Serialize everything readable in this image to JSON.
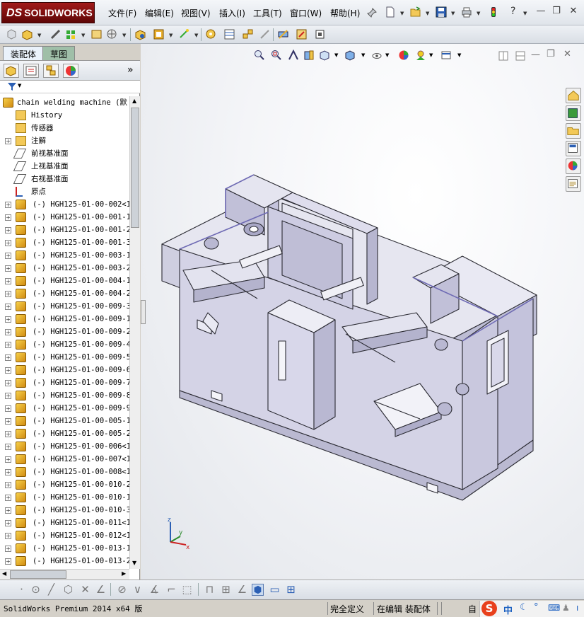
{
  "app": {
    "logo_prefix": "DS",
    "logo_text": "SOLIDWORKS"
  },
  "menu": [
    "文件(F)",
    "编辑(E)",
    "视图(V)",
    "插入(I)",
    "工具(T)",
    "窗口(W)",
    "帮助(H)"
  ],
  "titlebar_icons": [
    "pushpin-icon",
    "new-document-icon",
    "open-folder-icon",
    "save-icon",
    "print-icon",
    "rebuild-traffic-light-icon",
    "help-icon"
  ],
  "panel": {
    "tabs": [
      "装配体",
      "草图"
    ],
    "expand_symbol": "»"
  },
  "tree": [
    {
      "label": "chain welding machine (默",
      "icon": "assembly-icon",
      "expand": ""
    },
    {
      "label": "History",
      "icon": "history-icon",
      "expand": ""
    },
    {
      "label": "传感器",
      "icon": "sensor-icon",
      "expand": ""
    },
    {
      "label": "注解",
      "icon": "annotation-icon",
      "expand": "+"
    },
    {
      "label": "前视基准面",
      "icon": "plane-icon",
      "expand": ""
    },
    {
      "label": "上视基准面",
      "icon": "plane-icon",
      "expand": ""
    },
    {
      "label": "右视基准面",
      "icon": "plane-icon",
      "expand": ""
    },
    {
      "label": "原点",
      "icon": "origin-icon",
      "expand": ""
    },
    {
      "label": "(-) HGH125-01-00-002<1>",
      "icon": "part-icon",
      "expand": "+"
    },
    {
      "label": "(-) HGH125-01-00-001-1<",
      "icon": "part-icon",
      "expand": "+"
    },
    {
      "label": "(-) HGH125-01-00-001-2<",
      "icon": "part-icon",
      "expand": "+"
    },
    {
      "label": "(-) HGH125-01-00-001-3<",
      "icon": "part-icon",
      "expand": "+"
    },
    {
      "label": "(-) HGH125-01-00-003-1<",
      "icon": "part-icon",
      "expand": "+"
    },
    {
      "label": "(-) HGH125-01-00-003-2<",
      "icon": "part-icon",
      "expand": "+"
    },
    {
      "label": "(-) HGH125-01-00-004-1<",
      "icon": "part-icon",
      "expand": "+"
    },
    {
      "label": "(-) HGH125-01-00-004-2<",
      "icon": "part-icon",
      "expand": "+"
    },
    {
      "label": "(-) HGH125-01-00-009-3<",
      "icon": "part-icon",
      "expand": "+"
    },
    {
      "label": "(-) HGH125-01-00-009-1<",
      "icon": "part-icon",
      "expand": "+"
    },
    {
      "label": "(-) HGH125-01-00-009-2<",
      "icon": "part-icon",
      "expand": "+"
    },
    {
      "label": "(-) HGH125-01-00-009-4<",
      "icon": "part-icon",
      "expand": "+"
    },
    {
      "label": "(-) HGH125-01-00-009-5<",
      "icon": "part-icon",
      "expand": "+"
    },
    {
      "label": "(-) HGH125-01-00-009-6<",
      "icon": "part-icon",
      "expand": "+"
    },
    {
      "label": "(-) HGH125-01-00-009-7<",
      "icon": "part-icon",
      "expand": "+"
    },
    {
      "label": "(-) HGH125-01-00-009-8<",
      "icon": "part-icon",
      "expand": "+"
    },
    {
      "label": "(-) HGH125-01-00-009-9<",
      "icon": "part-icon",
      "expand": "+"
    },
    {
      "label": "(-) HGH125-01-00-005-1<",
      "icon": "part-icon",
      "expand": "+"
    },
    {
      "label": "(-) HGH125-01-00-005-2<",
      "icon": "part-icon",
      "expand": "+"
    },
    {
      "label": "(-) HGH125-01-00-006<1>",
      "icon": "part-icon",
      "expand": "+"
    },
    {
      "label": "(-) HGH125-01-00-007<1>",
      "icon": "part-icon",
      "expand": "+"
    },
    {
      "label": "(-) HGH125-01-00-008<1>",
      "icon": "part-icon",
      "expand": "+"
    },
    {
      "label": "(-) HGH125-01-00-010-2<",
      "icon": "part-icon",
      "expand": "+"
    },
    {
      "label": "(-) HGH125-01-00-010-1<",
      "icon": "part-icon",
      "expand": "+"
    },
    {
      "label": "(-) HGH125-01-00-010-3<",
      "icon": "part-icon",
      "expand": "+"
    },
    {
      "label": "(-) HGH125-01-00-011<1>",
      "icon": "part-icon",
      "expand": "+"
    },
    {
      "label": "(-) HGH125-01-00-012<1>",
      "icon": "part-icon",
      "expand": "+"
    },
    {
      "label": "(-) HGH125-01-00-013-1<",
      "icon": "part-icon",
      "expand": "+"
    },
    {
      "label": "(-) HGH125-01-00-013-2<",
      "icon": "part-icon",
      "expand": "+"
    }
  ],
  "triad": {
    "x": "x",
    "y": "y",
    "z": "z"
  },
  "status": {
    "product": "SolidWorks Premium 2014 x64 版",
    "definition": "完全定义",
    "mode": "在编辑 装配体",
    "units": "自"
  },
  "ime": {
    "lang": "中",
    "logo": "S"
  },
  "colors": {
    "accent": "#a11a1a",
    "model": "#d9d8ea",
    "edge": "#2b2b33",
    "highlight": "#6e6ab4"
  }
}
